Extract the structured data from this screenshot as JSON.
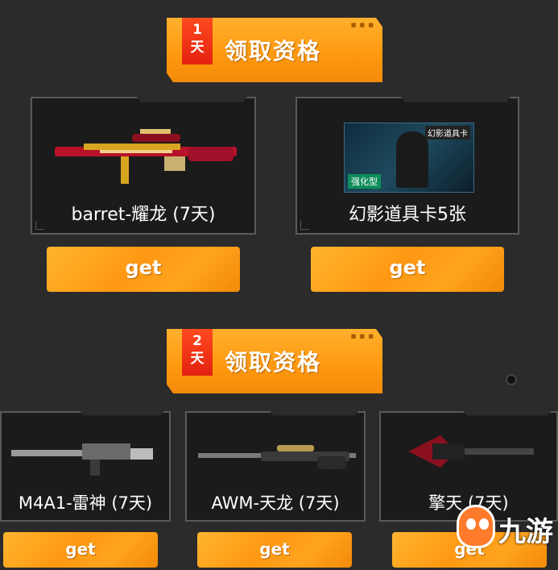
{
  "sections": [
    {
      "day_num": "1",
      "day_unit": "天",
      "title": "领取资格",
      "dots": "■ ■ ■"
    },
    {
      "day_num": "2",
      "day_unit": "天",
      "title": "领取资格",
      "dots": "■ ■ ■"
    }
  ],
  "day1_items": [
    {
      "label": "barret-耀龙 (7天)",
      "button": "get"
    },
    {
      "label": "幻影道具卡5张",
      "button": "get",
      "card_tag": "幻影道具卡",
      "card_badge": "强化型"
    }
  ],
  "day2_items": [
    {
      "label": "M4A1-雷神 (7天)",
      "button": "get"
    },
    {
      "label": "AWM-天龙 (7天)",
      "button": "get"
    },
    {
      "label": "擎天 (7天)",
      "button": "get"
    }
  ],
  "watermark": {
    "text": "九游"
  },
  "colors": {
    "accent": "#ff9a10",
    "day_tag": "#e32210",
    "card_bg": "#1b1b1b",
    "page_bg": "#2b2b2b"
  }
}
